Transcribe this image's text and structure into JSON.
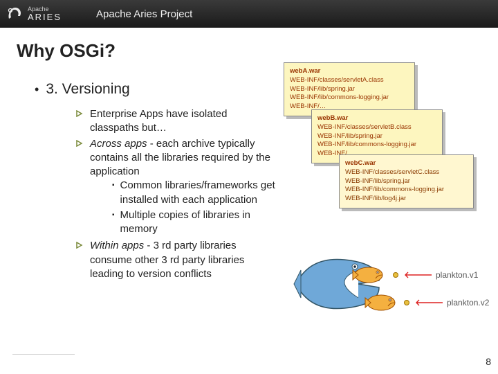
{
  "header": {
    "logo_small": "Apache",
    "logo_big": "ARIES",
    "project_title": "Apache Aries Project"
  },
  "slide": {
    "title": "Why OSGi?",
    "heading": "3. Versioning"
  },
  "bullets": {
    "b1_pre": "Enterprise Apps have isolated classpaths but…",
    "b2_em": "Across apps",
    "b2_rest": " - each archive typically contains all the libraries required by the application",
    "b2_sub1": "Common libraries/frameworks get installed with each application",
    "b2_sub2": "Multiple copies of libraries in memory",
    "b3_em": "Within apps",
    "b3_rest": " - 3 rd party libraries consume other 3 rd party libraries leading to version conflicts"
  },
  "notes": {
    "a": {
      "title": "webA.war",
      "l1": "WEB-INF/classes/servletA.class",
      "l2": "WEB-INF/lib/spring.jar",
      "l3": "WEB-INF/lib/commons-logging.jar",
      "l4": "WEB-INF/…"
    },
    "b": {
      "title": "webB.war",
      "l1": "WEB-INF/classes/servletB.class",
      "l2": "WEB-INF/lib/spring.jar",
      "l3": "WEB-INF/lib/commons-logging.jar",
      "l4": "WEB-INF/…"
    },
    "c": {
      "title": "webC.war",
      "l1": "WEB-INF/classes/servletC.class",
      "l2": "WEB-INF/lib/spring.jar",
      "l3": "WEB-INF/lib/commons-logging.jar",
      "l4": "WEB-INF/lib/log4j.jar"
    }
  },
  "fish": {
    "label1": "plankton.v1",
    "label2": "plankton.v2"
  },
  "page_number": "8"
}
